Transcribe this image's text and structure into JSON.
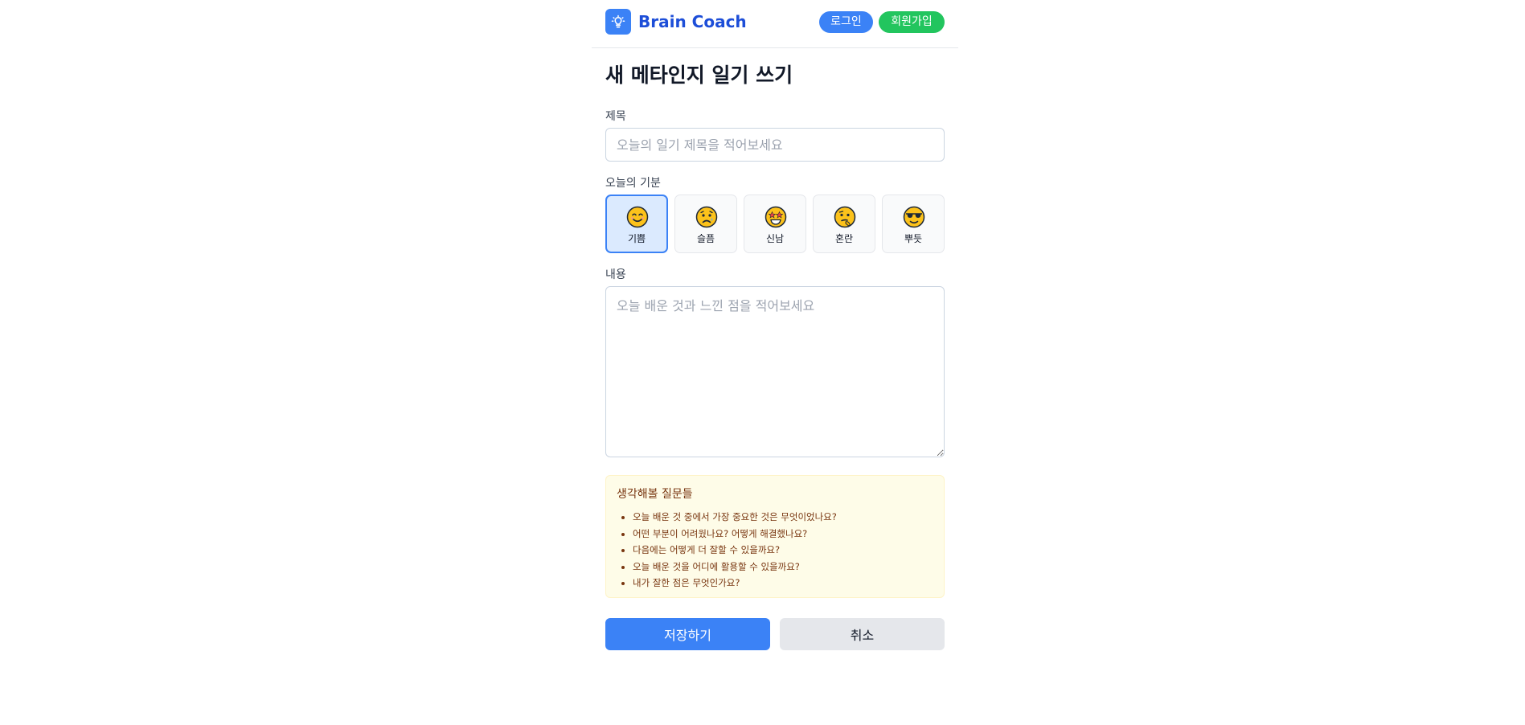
{
  "header": {
    "brand": "Brain Coach",
    "logo_icon": "lightbulb-icon",
    "login_label": "로그인",
    "signup_label": "회원가입"
  },
  "page": {
    "title": "새 메타인지 일기 쓰기"
  },
  "form": {
    "title_label": "제목",
    "title_placeholder": "오늘의 일기 제목을 적어보세요",
    "title_value": "",
    "mood_label": "오늘의 기분",
    "moods": [
      {
        "label": "기쁨",
        "icon": "smiling-face-icon",
        "selected": true
      },
      {
        "label": "슬픔",
        "icon": "sad-face-icon",
        "selected": false
      },
      {
        "label": "신남",
        "icon": "star-struck-face-icon",
        "selected": false
      },
      {
        "label": "혼란",
        "icon": "confused-face-icon",
        "selected": false
      },
      {
        "label": "뿌듯",
        "icon": "sunglasses-face-icon",
        "selected": false
      }
    ],
    "content_label": "내용",
    "content_placeholder": "오늘 배운 것과 느낀 점을 적어보세요",
    "content_value": ""
  },
  "tips": {
    "title": "생각해볼 질문들",
    "items": [
      "오늘 배운 것 중에서 가장 중요한 것은 무엇이었나요?",
      "어떤 부분이 어려웠나요? 어떻게 해결했나요?",
      "다음에는 어떻게 더 잘할 수 있을까요?",
      "오늘 배운 것을 어디에 활용할 수 있을까요?",
      "내가 잘한 점은 무엇인가요?"
    ]
  },
  "actions": {
    "save_label": "저장하기",
    "cancel_label": "취소"
  },
  "colors": {
    "primary": "#3b82f6",
    "signup": "#22c55e",
    "brand_text": "#1d4ed8",
    "tips_bg": "#fefce8",
    "tips_text": "#78350f",
    "cancel_bg": "#e5e7eb"
  }
}
